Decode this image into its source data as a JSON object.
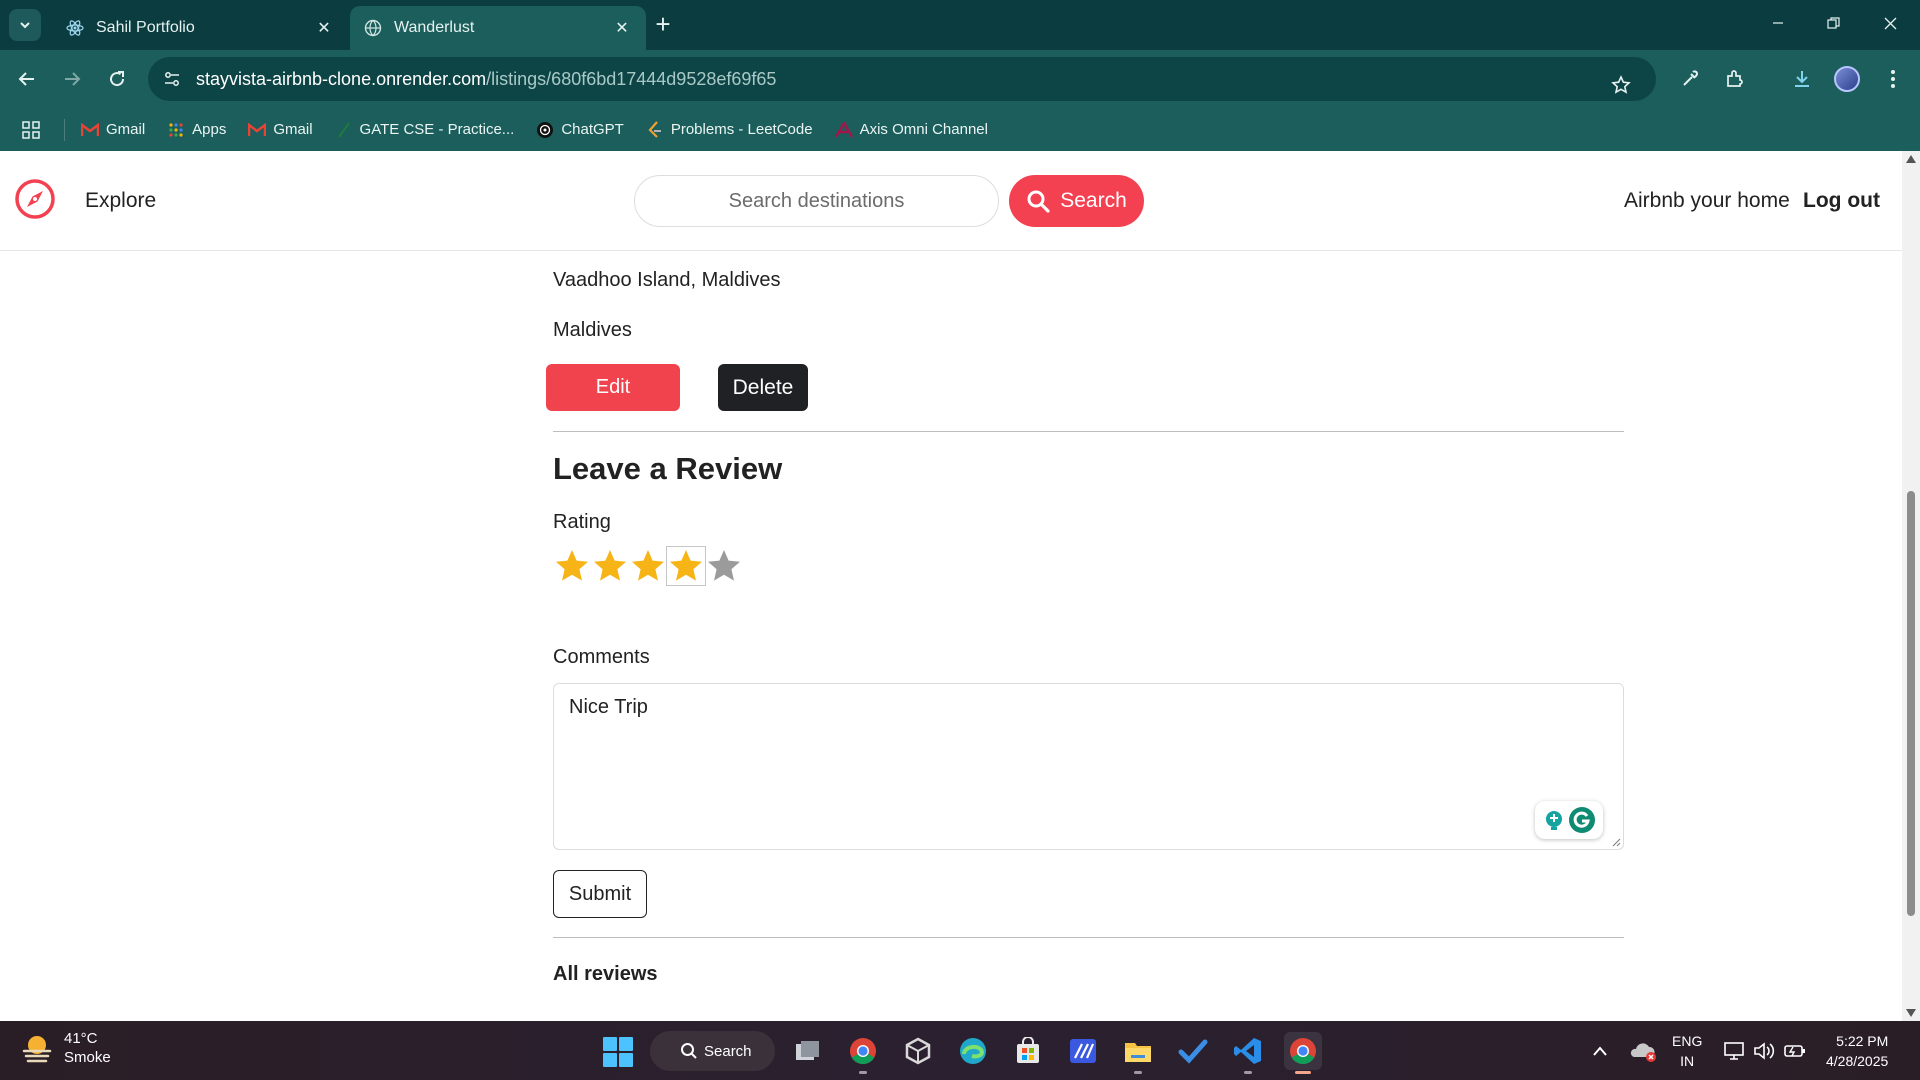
{
  "browser": {
    "tabs": [
      {
        "title": "Sahil Portfolio",
        "favicon": "react-icon",
        "active": false
      },
      {
        "title": "Wanderlust",
        "favicon": "globe-icon",
        "active": true
      }
    ],
    "url": {
      "host": "stayvista-airbnb-clone.onrender.com",
      "path": "/listings/680f6bd17444d9528ef69f65"
    },
    "bookmarks": [
      {
        "label": "Gmail",
        "icon": "gmail-icon"
      },
      {
        "label": "Apps",
        "icon": "apps-grid-icon"
      },
      {
        "label": "Gmail",
        "icon": "gmail-icon"
      },
      {
        "label": "GATE CSE - Practice...",
        "icon": "gate-icon"
      },
      {
        "label": "ChatGPT",
        "icon": "chatgpt-icon"
      },
      {
        "label": "Problems - LeetCode",
        "icon": "leetcode-icon"
      },
      {
        "label": "Axis Omni Channel",
        "icon": "axis-icon"
      }
    ],
    "theme_color": "#1b5e5b"
  },
  "navbar": {
    "explore_label": "Explore",
    "search_placeholder": "Search destinations",
    "search_button": "Search",
    "host_link": "Airbnb your home",
    "logout_link": "Log out",
    "brand_color": "#f44152"
  },
  "listing": {
    "location": "Vaadhoo Island, Maldives",
    "country": "Maldives",
    "edit_button": "Edit",
    "delete_button": "Delete"
  },
  "review_form": {
    "title": "Leave a Review",
    "rating_label": "Rating",
    "rating_value": 4,
    "rating_max": 5,
    "comments_label": "Comments",
    "comment_value": "Nice Trip",
    "submit_button": "Submit"
  },
  "reviews": {
    "heading": "All reviews"
  },
  "taskbar": {
    "weather_temp": "41°C",
    "weather_desc": "Smoke",
    "search_label": "Search",
    "language_line1": "ENG",
    "language_line2": "IN",
    "time": "5:22 PM",
    "date": "4/28/2025"
  }
}
